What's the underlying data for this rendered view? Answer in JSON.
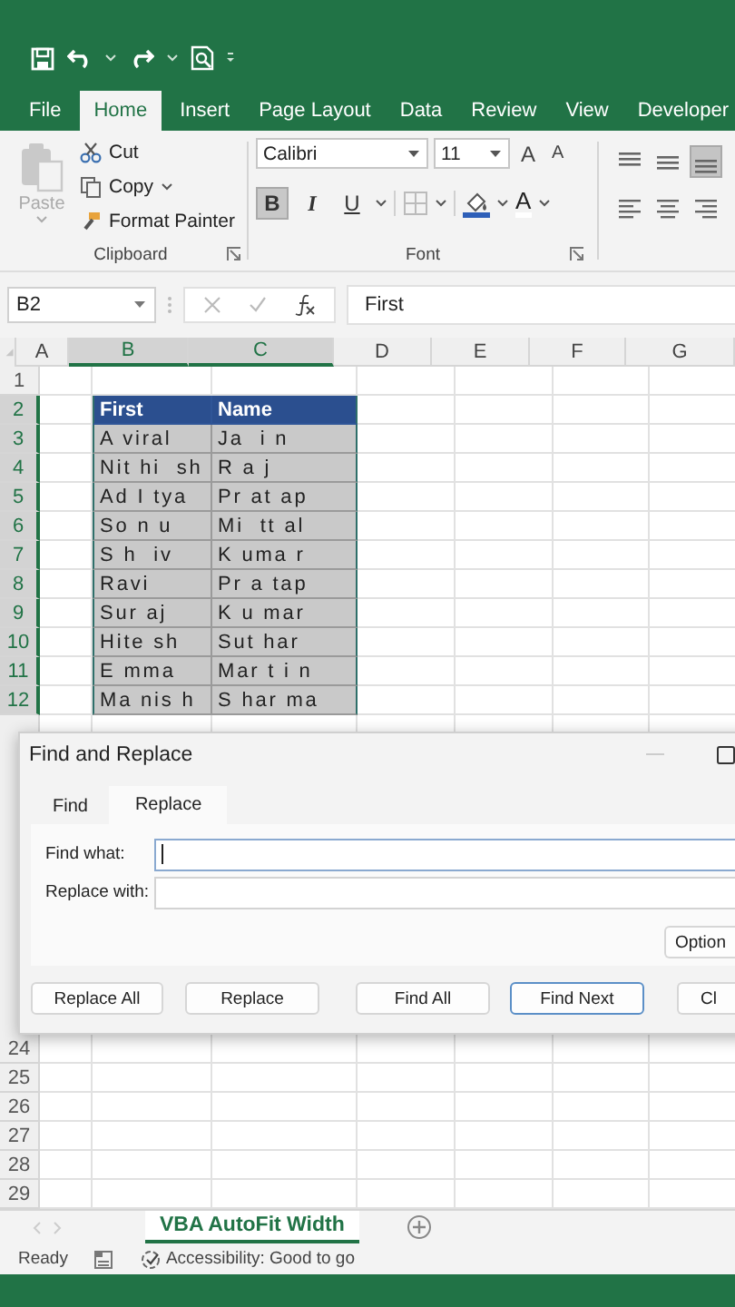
{
  "ribbon_tabs": [
    {
      "label": "File",
      "selected": false
    },
    {
      "label": "Home",
      "selected": true
    },
    {
      "label": "Insert",
      "selected": false
    },
    {
      "label": "Page Layout",
      "selected": false
    },
    {
      "label": "Data",
      "selected": false
    },
    {
      "label": "Review",
      "selected": false
    },
    {
      "label": "View",
      "selected": false
    },
    {
      "label": "Developer",
      "selected": false
    }
  ],
  "clipboard": {
    "paste": "Paste",
    "paste_disabled": true,
    "cut": "Cut",
    "copy": "Copy",
    "format_painter": "Format Painter",
    "label": "Clipboard"
  },
  "font": {
    "name": "Calibri",
    "size": "11",
    "grow": "A",
    "shrink": "A",
    "buttons": [
      {
        "label": "B",
        "kind": "bold",
        "on": true
      },
      {
        "label": "I",
        "kind": "italic",
        "on": false
      },
      {
        "label": "U",
        "kind": "underline",
        "on": false
      }
    ],
    "font_color": "A",
    "label": "Font"
  },
  "alignment": [
    {
      "kind": "top",
      "on": false
    },
    {
      "kind": "middle",
      "on": false
    },
    {
      "kind": "bottom",
      "on": true
    },
    {
      "kind": "left",
      "on": false
    },
    {
      "kind": "center",
      "on": false
    },
    {
      "kind": "right",
      "on": false
    }
  ],
  "formula_bar": {
    "name_box": "B2",
    "formula": "First"
  },
  "columns": [
    {
      "label": "A",
      "selected": false
    },
    {
      "label": "B",
      "selected": true
    },
    {
      "label": "C",
      "selected": true
    },
    {
      "label": "D",
      "selected": false
    },
    {
      "label": "E",
      "selected": false
    },
    {
      "label": "F",
      "selected": false
    },
    {
      "label": "G",
      "selected": false
    }
  ],
  "row_numbers": [
    {
      "label": "1",
      "selected": false
    },
    {
      "label": "2",
      "selected": true
    },
    {
      "label": "3",
      "selected": true
    },
    {
      "label": "4",
      "selected": true
    },
    {
      "label": "5",
      "selected": true
    },
    {
      "label": "6",
      "selected": true
    },
    {
      "label": "7",
      "selected": true
    },
    {
      "label": "8",
      "selected": true
    },
    {
      "label": "9",
      "selected": true
    },
    {
      "label": "10",
      "selected": true
    },
    {
      "label": "11",
      "selected": true
    },
    {
      "label": "12",
      "selected": true
    },
    {
      "label": "24",
      "selected": false
    },
    {
      "label": "25",
      "selected": false
    },
    {
      "label": "26",
      "selected": false
    },
    {
      "label": "27",
      "selected": false
    },
    {
      "label": "28",
      "selected": false
    },
    {
      "label": "29",
      "selected": false
    }
  ],
  "table": {
    "selected": true,
    "header": [
      "First",
      "Name"
    ],
    "rows": [
      [
        "A viral",
        "Ja  i n"
      ],
      [
        "Nit hi  sh",
        "R a j"
      ],
      [
        "Ad I tya",
        "Pr at ap"
      ],
      [
        "So n u",
        "Mi  tt al"
      ],
      [
        "S h  iv",
        "K uma r"
      ],
      [
        "Ravi",
        "Pr a tap"
      ],
      [
        "Sur aj",
        "K u mar"
      ],
      [
        "Hite sh",
        "Sut har"
      ],
      [
        "E mma",
        "Mar t i n"
      ],
      [
        "Ma nis h",
        "S har ma"
      ]
    ]
  },
  "dialog": {
    "title": "Find and Replace",
    "tabs": [
      {
        "label": "Find",
        "selected": false
      },
      {
        "label": "Replace",
        "selected": true
      }
    ],
    "fields": [
      {
        "label": "Find what:",
        "focused": true
      },
      {
        "label": "Replace with:",
        "focused": false
      }
    ],
    "options": "Option",
    "buttons": [
      {
        "label": "Replace All",
        "default": false
      },
      {
        "label": "Replace",
        "default": false
      },
      {
        "label": "Find All",
        "default": false
      },
      {
        "label": "Find Next",
        "default": true
      },
      {
        "label": "Cl",
        "default": false
      }
    ]
  },
  "sheet_tabs": [
    {
      "label": "VBA AutoFit Width",
      "selected": true
    }
  ],
  "status_bar": {
    "ready": "Ready",
    "accessibility": "Accessibility: Good to go"
  }
}
